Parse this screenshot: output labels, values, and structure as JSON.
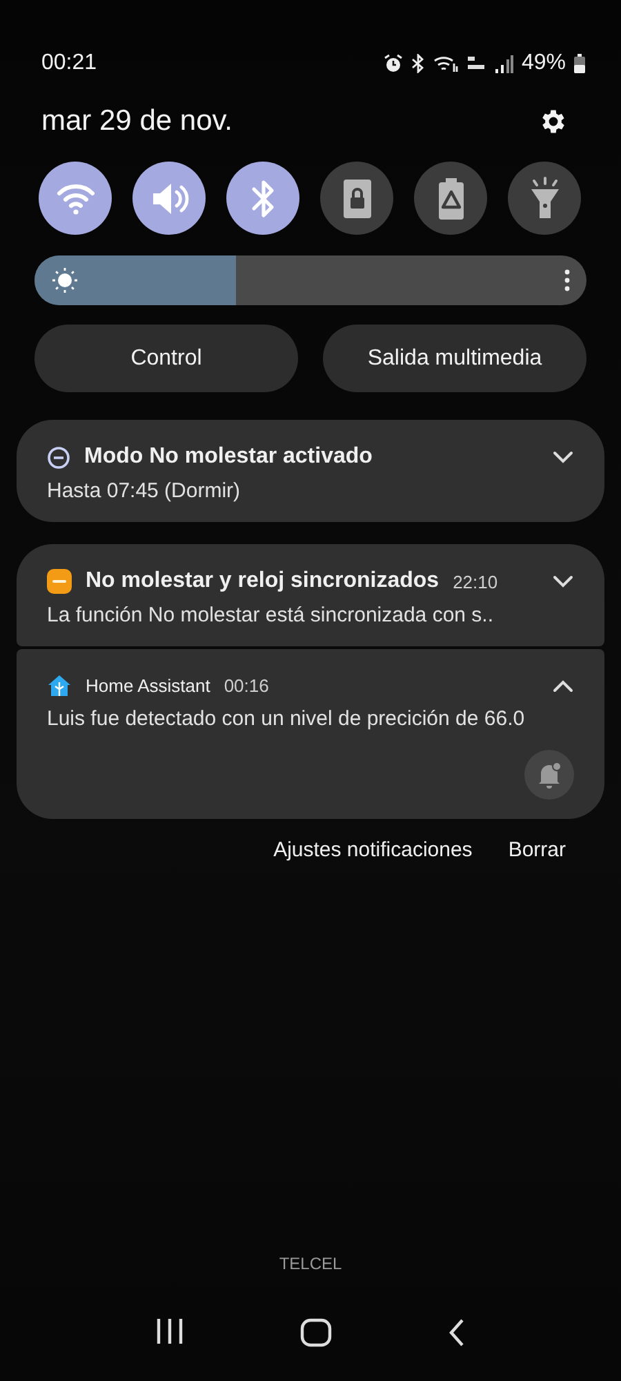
{
  "status_bar": {
    "time": "00:21",
    "battery": "49%"
  },
  "date": "mar 29 de nov.",
  "quick_toggles": [
    {
      "kind": "wifi",
      "on": true
    },
    {
      "kind": "sound",
      "on": true
    },
    {
      "kind": "bluetooth",
      "on": true
    },
    {
      "kind": "lock",
      "on": false
    },
    {
      "kind": "battery",
      "on": false
    },
    {
      "kind": "flashlight",
      "on": false
    }
  ],
  "brightness": {
    "level": 0.365
  },
  "panel_buttons": [
    "Control",
    "Salida multimedia"
  ],
  "notification_groups": [
    {
      "items": [
        {
          "kind": "dnd",
          "title": "Modo No molestar activado",
          "body": "Hasta 07:45 (Dormir)",
          "expanded": false
        }
      ]
    },
    {
      "items": [
        {
          "kind": "wear",
          "title": "No molestar y reloj sincronizados",
          "time": "22:10",
          "body": "La función No molestar está sincronizada con s..",
          "expanded": false
        },
        {
          "kind": "home",
          "title": "Home Assistant",
          "time": "00:16",
          "body": "Luis fue detectado con un nivel de precición de 66.0",
          "expanded": true
        }
      ]
    }
  ],
  "actions": [
    "Ajustes notificaciones",
    "Borrar"
  ],
  "carrier": "TELCEL"
}
